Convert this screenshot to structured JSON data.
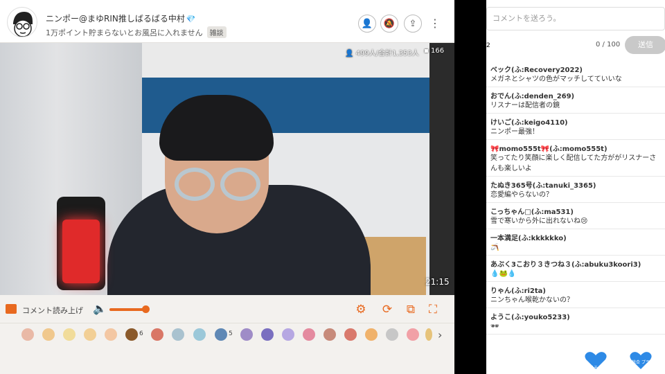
{
  "header": {
    "channel_name": "ニンポー@まゆRIN推しばるばる中村",
    "gem_icon": "diamond-icon",
    "stream_title": "1万ポイント貯まらないとお風呂に入れません",
    "category_tag": "雑談"
  },
  "video": {
    "viewers": "499人/合計1,353人",
    "comments": "166",
    "elapsed": "21:15"
  },
  "controls": {
    "read_aloud_label": "コメント読み上げ",
    "volume_level": 0.85,
    "accent_color": "#e8691f"
  },
  "gifts": {
    "count_a": "6",
    "count_b": "5"
  },
  "chat": {
    "input_placeholder": "コメントを送ろう。",
    "char_count": "0 / 100",
    "send_label": "送信",
    "edge_number": "2",
    "comments": [
      {
        "name": "ベック(ふ:Recovery2022)",
        "text": "メガネとシャツの色がマッチしてていいな"
      },
      {
        "name": "おでん(ふ:denden_269)",
        "text": "リスナーは配信者の鏡"
      },
      {
        "name": "けいご(ふ:keigo4110)",
        "text": "ニンポー最強！"
      },
      {
        "name": "🎀momo555t🎀(ふ:momo555t)",
        "text": "笑ってたり笑顔に楽しく配信してた方ががリスナーさんも楽しいよ"
      },
      {
        "name": "たぬき365号(ふ:tanuki_3365)",
        "text": "恋愛編やらないの？"
      },
      {
        "name": "こっちゃん□(ふ:ma531)",
        "text": "雪で寒いから外に出れないね😢"
      },
      {
        "name": "一本満足(ふ:kkkkkko)",
        "text": "🪃"
      },
      {
        "name": "あぶく3こおり３きつね３(ふ:abuku3koori3)",
        "text": "💧🐸💧"
      },
      {
        "name": "りゃん(ふ:ri2ta)",
        "text": "ニンちゃん喉乾かないの？"
      },
      {
        "name": "ようこ(ふ:youko5233)",
        "text": "🕶"
      }
    ],
    "badge_a": "プラチナ C",
    "badge_b": "後半総合 プラチナ"
  }
}
